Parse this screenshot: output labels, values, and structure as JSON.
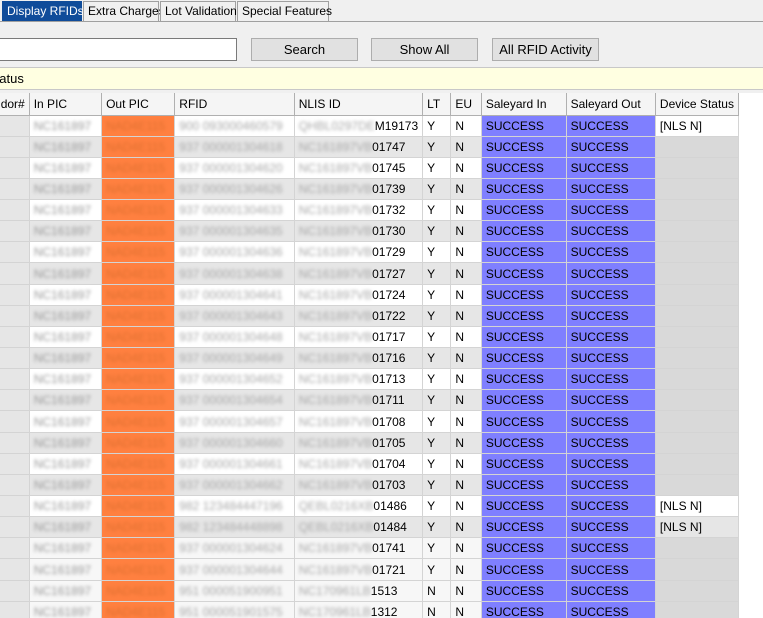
{
  "tabs": [
    {
      "label": "Display RFIDs",
      "active": true
    },
    {
      "label": "Extra Charges",
      "active": false
    },
    {
      "label": "Lot Validation",
      "active": false
    },
    {
      "label": "Special Features",
      "active": false
    }
  ],
  "search": {
    "value": "",
    "placeholder": ""
  },
  "buttons": {
    "search": "Search",
    "show_all": "Show All",
    "all_activity": "All RFID Activity"
  },
  "status_text": "Status",
  "columns": [
    "Vendor#",
    "In PIC",
    "Out PIC",
    "RFID",
    "NLIS ID",
    "LT",
    "EU",
    "Saleyard In",
    "Saleyard Out",
    "Device Status"
  ],
  "rows": [
    {
      "in_pic": "NC161897",
      "out_pic": "NAD4E115",
      "rfid": "900 093000460579",
      "nlis_mask": "QHBL0297DE",
      "nlis_tail": "M19173",
      "lt": "Y",
      "eu": "N",
      "sy_in": "SUCCESS",
      "sy_out": "SUCCESS",
      "dev": "[NLS N]"
    },
    {
      "in_pic": "NC161897",
      "out_pic": "NAD4E115",
      "rfid": "937 000001304618",
      "nlis_mask": "NC161897VB",
      "nlis_tail": "01747",
      "lt": "Y",
      "eu": "N",
      "sy_in": "SUCCESS",
      "sy_out": "SUCCESS",
      "dev": ""
    },
    {
      "in_pic": "NC161897",
      "out_pic": "NAD4E115",
      "rfid": "937 000001304620",
      "nlis_mask": "NC161897VB",
      "nlis_tail": "01745",
      "lt": "Y",
      "eu": "N",
      "sy_in": "SUCCESS",
      "sy_out": "SUCCESS",
      "dev": ""
    },
    {
      "in_pic": "NC161897",
      "out_pic": "NAD4E115",
      "rfid": "937 000001304626",
      "nlis_mask": "NC161897VB",
      "nlis_tail": "01739",
      "lt": "Y",
      "eu": "N",
      "sy_in": "SUCCESS",
      "sy_out": "SUCCESS",
      "dev": ""
    },
    {
      "in_pic": "NC161897",
      "out_pic": "NAD4E115",
      "rfid": "937 000001304633",
      "nlis_mask": "NC161897VB",
      "nlis_tail": "01732",
      "lt": "Y",
      "eu": "N",
      "sy_in": "SUCCESS",
      "sy_out": "SUCCESS",
      "dev": ""
    },
    {
      "in_pic": "NC161897",
      "out_pic": "NAD4E115",
      "rfid": "937 000001304635",
      "nlis_mask": "NC161897VB",
      "nlis_tail": "01730",
      "lt": "Y",
      "eu": "N",
      "sy_in": "SUCCESS",
      "sy_out": "SUCCESS",
      "dev": ""
    },
    {
      "in_pic": "NC161897",
      "out_pic": "NAD4E115",
      "rfid": "937 000001304636",
      "nlis_mask": "NC161897VB",
      "nlis_tail": "01729",
      "lt": "Y",
      "eu": "N",
      "sy_in": "SUCCESS",
      "sy_out": "SUCCESS",
      "dev": ""
    },
    {
      "in_pic": "NC161897",
      "out_pic": "NAD4E115",
      "rfid": "937 000001304638",
      "nlis_mask": "NC161897VB",
      "nlis_tail": "01727",
      "lt": "Y",
      "eu": "N",
      "sy_in": "SUCCESS",
      "sy_out": "SUCCESS",
      "dev": ""
    },
    {
      "in_pic": "NC161897",
      "out_pic": "NAD4E115",
      "rfid": "937 000001304641",
      "nlis_mask": "NC161897VB",
      "nlis_tail": "01724",
      "lt": "Y",
      "eu": "N",
      "sy_in": "SUCCESS",
      "sy_out": "SUCCESS",
      "dev": ""
    },
    {
      "in_pic": "NC161897",
      "out_pic": "NAD4E115",
      "rfid": "937 000001304643",
      "nlis_mask": "NC161897VB",
      "nlis_tail": "01722",
      "lt": "Y",
      "eu": "N",
      "sy_in": "SUCCESS",
      "sy_out": "SUCCESS",
      "dev": ""
    },
    {
      "in_pic": "NC161897",
      "out_pic": "NAD4E115",
      "rfid": "937 000001304648",
      "nlis_mask": "NC161897VB",
      "nlis_tail": "01717",
      "lt": "Y",
      "eu": "N",
      "sy_in": "SUCCESS",
      "sy_out": "SUCCESS",
      "dev": ""
    },
    {
      "in_pic": "NC161897",
      "out_pic": "NAD4E115",
      "rfid": "937 000001304649",
      "nlis_mask": "NC161897VB",
      "nlis_tail": "01716",
      "lt": "Y",
      "eu": "N",
      "sy_in": "SUCCESS",
      "sy_out": "SUCCESS",
      "dev": ""
    },
    {
      "in_pic": "NC161897",
      "out_pic": "NAD4E115",
      "rfid": "937 000001304652",
      "nlis_mask": "NC161897VB",
      "nlis_tail": "01713",
      "lt": "Y",
      "eu": "N",
      "sy_in": "SUCCESS",
      "sy_out": "SUCCESS",
      "dev": ""
    },
    {
      "in_pic": "NC161897",
      "out_pic": "NAD4E115",
      "rfid": "937 000001304654",
      "nlis_mask": "NC161897VB",
      "nlis_tail": "01711",
      "lt": "Y",
      "eu": "N",
      "sy_in": "SUCCESS",
      "sy_out": "SUCCESS",
      "dev": ""
    },
    {
      "in_pic": "NC161897",
      "out_pic": "NAD4E115",
      "rfid": "937 000001304657",
      "nlis_mask": "NC161897VB",
      "nlis_tail": "01708",
      "lt": "Y",
      "eu": "N",
      "sy_in": "SUCCESS",
      "sy_out": "SUCCESS",
      "dev": ""
    },
    {
      "in_pic": "NC161897",
      "out_pic": "NAD4E115",
      "rfid": "937 000001304660",
      "nlis_mask": "NC161897VB",
      "nlis_tail": "01705",
      "lt": "Y",
      "eu": "N",
      "sy_in": "SUCCESS",
      "sy_out": "SUCCESS",
      "dev": ""
    },
    {
      "in_pic": "NC161897",
      "out_pic": "NAD4E115",
      "rfid": "937 000001304661",
      "nlis_mask": "NC161897VB",
      "nlis_tail": "01704",
      "lt": "Y",
      "eu": "N",
      "sy_in": "SUCCESS",
      "sy_out": "SUCCESS",
      "dev": ""
    },
    {
      "in_pic": "NC161897",
      "out_pic": "NAD4E115",
      "rfid": "937 000001304662",
      "nlis_mask": "NC161897VB",
      "nlis_tail": "01703",
      "lt": "Y",
      "eu": "N",
      "sy_in": "SUCCESS",
      "sy_out": "SUCCESS",
      "dev": ""
    },
    {
      "in_pic": "NC161897",
      "out_pic": "NAD4E115",
      "rfid": "982 123484447196",
      "nlis_mask": "QEBL0216XB",
      "nlis_tail": "01486",
      "lt": "Y",
      "eu": "N",
      "sy_in": "SUCCESS",
      "sy_out": "SUCCESS",
      "dev": "[NLS N]"
    },
    {
      "in_pic": "NC161897",
      "out_pic": "NAD4E115",
      "rfid": "982 123484448898",
      "nlis_mask": "QEBL0216XB",
      "nlis_tail": "01484",
      "lt": "Y",
      "eu": "N",
      "sy_in": "SUCCESS",
      "sy_out": "SUCCESS",
      "dev": "[NLS N]"
    },
    {
      "in_pic": "NC161897",
      "out_pic": "NAD4E115",
      "rfid": "937 000001304624",
      "nlis_mask": "NC161897VB",
      "nlis_tail": "01741",
      "lt": "Y",
      "eu": "N",
      "sy_in": "SUCCESS",
      "sy_out": "SUCCESS",
      "dev": ""
    },
    {
      "in_pic": "NC161897",
      "out_pic": "NAD4E115",
      "rfid": "937 000001304644",
      "nlis_mask": "NC161897VB",
      "nlis_tail": "01721",
      "lt": "Y",
      "eu": "N",
      "sy_in": "SUCCESS",
      "sy_out": "SUCCESS",
      "dev": ""
    },
    {
      "in_pic": "NC161897",
      "out_pic": "NAD4E115",
      "rfid": "951 000051900951",
      "nlis_mask": "NC170961LB",
      "nlis_tail": "1513",
      "lt": "N",
      "eu": "N",
      "sy_in": "SUCCESS",
      "sy_out": "SUCCESS",
      "dev": ""
    },
    {
      "in_pic": "NC161897",
      "out_pic": "NAD4E115",
      "rfid": "951 000051901575",
      "nlis_mask": "NC170961LB",
      "nlis_tail": "1312",
      "lt": "N",
      "eu": "N",
      "sy_in": "SUCCESS",
      "sy_out": "SUCCESS",
      "dev": ""
    }
  ]
}
